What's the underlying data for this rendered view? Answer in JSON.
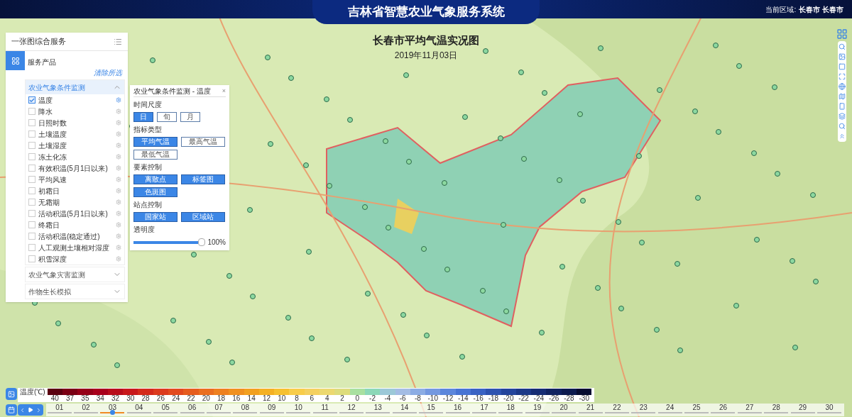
{
  "header": {
    "title": "吉林省智慧农业气象服务系统",
    "region_label": "当前区域:",
    "region": "长春市 长春市"
  },
  "map": {
    "kind": "picture",
    "title": "长春市平均气温实况图",
    "date": "2019年11月03日"
  },
  "panel": {
    "title": "一张图综合服务",
    "section": "服务产品",
    "clear": "清除所选",
    "groups": [
      {
        "label": "农业气象条件监测",
        "expanded": true,
        "items": [
          {
            "label": "温度",
            "checked": true
          },
          {
            "label": "降水",
            "checked": false
          },
          {
            "label": "日照时数",
            "checked": false
          },
          {
            "label": "土壤温度",
            "checked": false
          },
          {
            "label": "土壤湿度",
            "checked": false
          },
          {
            "label": "冻土化冻",
            "checked": false
          },
          {
            "label": "有效积温(5月1日以来)",
            "checked": false
          },
          {
            "label": "平均风速",
            "checked": false
          },
          {
            "label": "初霜日",
            "checked": false
          },
          {
            "label": "无霜期",
            "checked": false
          },
          {
            "label": "活动积温(5月1日以来)",
            "checked": false
          },
          {
            "label": "终霜日",
            "checked": false
          },
          {
            "label": "活动积温(稳定通过)",
            "checked": false
          },
          {
            "label": "人工观测土壤相对湿度",
            "checked": false
          },
          {
            "label": "积雪深度",
            "checked": false
          }
        ]
      },
      {
        "label": "农业气象灾害监测",
        "expanded": false
      },
      {
        "label": "作物生长模拟",
        "expanded": false
      }
    ]
  },
  "popup": {
    "title": "农业气象条件监测 - 温度",
    "close": "×",
    "sections": [
      {
        "label": "时间尺度",
        "kind": "small",
        "options": [
          {
            "label": "日",
            "selected": true
          },
          {
            "label": "旬",
            "selected": false
          },
          {
            "label": "月",
            "selected": false
          }
        ]
      },
      {
        "label": "指标类型",
        "kind": "wide",
        "options": [
          {
            "label": "平均气温",
            "selected": true
          },
          {
            "label": "最高气温",
            "selected": false
          },
          {
            "label": "最低气温",
            "selected": false
          }
        ]
      },
      {
        "label": "要素控制",
        "kind": "wide",
        "options": [
          {
            "label": "离散点",
            "selected": true
          },
          {
            "label": "标签图",
            "selected": true
          },
          {
            "label": "色斑图",
            "selected": true
          }
        ]
      },
      {
        "label": "站点控制",
        "kind": "wide",
        "options": [
          {
            "label": "国家站",
            "selected": true
          },
          {
            "label": "区域站",
            "selected": true
          }
        ]
      }
    ],
    "opacity": {
      "label": "透明度",
      "level": 1,
      "reading": "100%"
    }
  },
  "legend": {
    "label": "温度(℃)",
    "ticks": [
      {
        "label": "40",
        "color": "#5a0010"
      },
      {
        "label": "37",
        "color": "#7a0014"
      },
      {
        "label": "35",
        "color": "#950018"
      },
      {
        "label": "34",
        "color": "#a8001c"
      },
      {
        "label": "32",
        "color": "#b80d1c"
      },
      {
        "label": "30",
        "color": "#c8181c"
      },
      {
        "label": "28",
        "color": "#d42a1c"
      },
      {
        "label": "26",
        "color": "#dc3a1e"
      },
      {
        "label": "24",
        "color": "#e24a1e"
      },
      {
        "label": "22",
        "color": "#e65c1e"
      },
      {
        "label": "20",
        "color": "#ea6e20"
      },
      {
        "label": "18",
        "color": "#ee8020"
      },
      {
        "label": "16",
        "color": "#f09020"
      },
      {
        "label": "14",
        "color": "#f2a020"
      },
      {
        "label": "12",
        "color": "#f4b024"
      },
      {
        "label": "10",
        "color": "#f6c030"
      },
      {
        "label": "8",
        "color": "#f8cc4a"
      },
      {
        "label": "6",
        "color": "#f4d060"
      },
      {
        "label": "4",
        "color": "#ecd870"
      },
      {
        "label": "2",
        "color": "#dedc7c"
      },
      {
        "label": "0",
        "color": "#a8e0a0"
      },
      {
        "label": "-2",
        "color": "#8cd8b8"
      },
      {
        "label": "-4",
        "color": "#9cc8d8"
      },
      {
        "label": "-6",
        "color": "#a4bce4"
      },
      {
        "label": "-8",
        "color": "#8cace4"
      },
      {
        "label": "-10",
        "color": "#7498e0"
      },
      {
        "label": "-12",
        "color": "#5c86dc"
      },
      {
        "label": "-14",
        "color": "#4874d4"
      },
      {
        "label": "-16",
        "color": "#3a62c4"
      },
      {
        "label": "-18",
        "color": "#2e52b0"
      },
      {
        "label": "-20",
        "color": "#24449c"
      },
      {
        "label": "-22",
        "color": "#1c3888"
      },
      {
        "label": "-24",
        "color": "#162c74"
      },
      {
        "label": "-26",
        "color": "#102260"
      },
      {
        "label": "-28",
        "color": "#0c1a4e"
      },
      {
        "label": "-30",
        "color": "#060c30"
      }
    ]
  },
  "timeline": {
    "days": [
      {
        "label": "01",
        "selected": false
      },
      {
        "label": "02",
        "selected": false
      },
      {
        "label": "03",
        "selected": true
      },
      {
        "label": "04",
        "selected": false
      },
      {
        "label": "05",
        "selected": false
      },
      {
        "label": "06",
        "selected": false
      },
      {
        "label": "07",
        "selected": false
      },
      {
        "label": "08",
        "selected": false
      },
      {
        "label": "09",
        "selected": false
      },
      {
        "label": "10",
        "selected": false
      },
      {
        "label": "11",
        "selected": false
      },
      {
        "label": "12",
        "selected": false
      },
      {
        "label": "13",
        "selected": false
      },
      {
        "label": "14",
        "selected": false
      },
      {
        "label": "15",
        "selected": false
      },
      {
        "label": "16",
        "selected": false
      },
      {
        "label": "17",
        "selected": false
      },
      {
        "label": "18",
        "selected": false
      },
      {
        "label": "19",
        "selected": false
      },
      {
        "label": "20",
        "selected": false
      },
      {
        "label": "21",
        "selected": false
      },
      {
        "label": "22",
        "selected": false
      },
      {
        "label": "23",
        "selected": false
      },
      {
        "label": "24",
        "selected": false
      },
      {
        "label": "25",
        "selected": false
      },
      {
        "label": "26",
        "selected": false
      },
      {
        "label": "27",
        "selected": false
      },
      {
        "label": "28",
        "selected": false
      },
      {
        "label": "29",
        "selected": false
      },
      {
        "label": "30",
        "selected": false
      }
    ]
  }
}
